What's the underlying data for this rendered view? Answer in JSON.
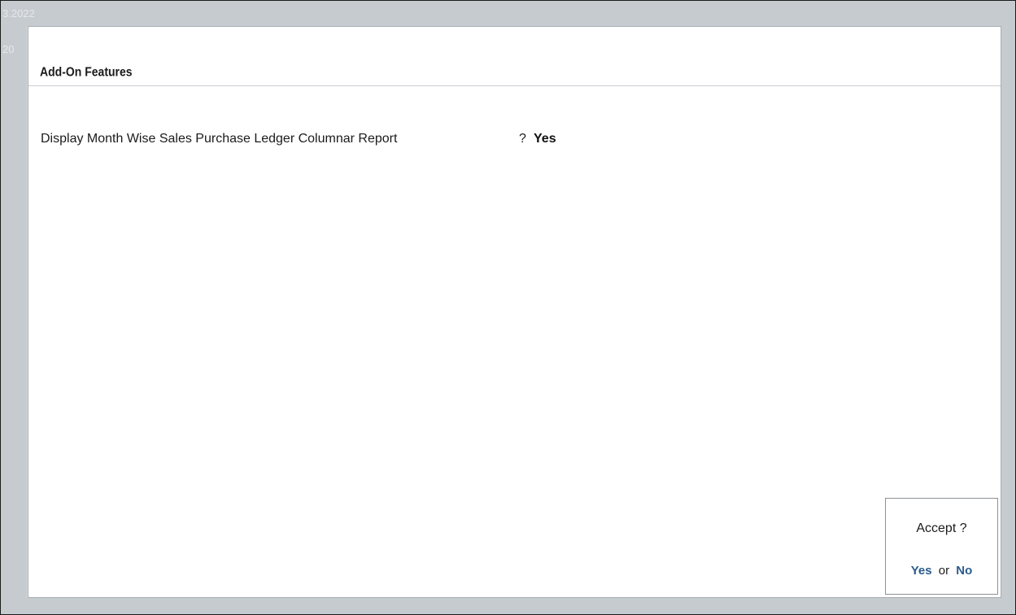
{
  "background": {
    "line1": "3.2022",
    "line2": "20"
  },
  "panel": {
    "title": "Add-On Features"
  },
  "field": {
    "label": "Display Month Wise Sales Purchase Ledger Columnar Report",
    "separator": "?",
    "value": "Yes"
  },
  "accept": {
    "title": "Accept ?",
    "yes_label": "Yes",
    "or_label": "or",
    "no_label": "No"
  },
  "colors": {
    "background": "#c6cbcf",
    "panel": "#ffffff",
    "option_accent": "#2b5b8e"
  }
}
